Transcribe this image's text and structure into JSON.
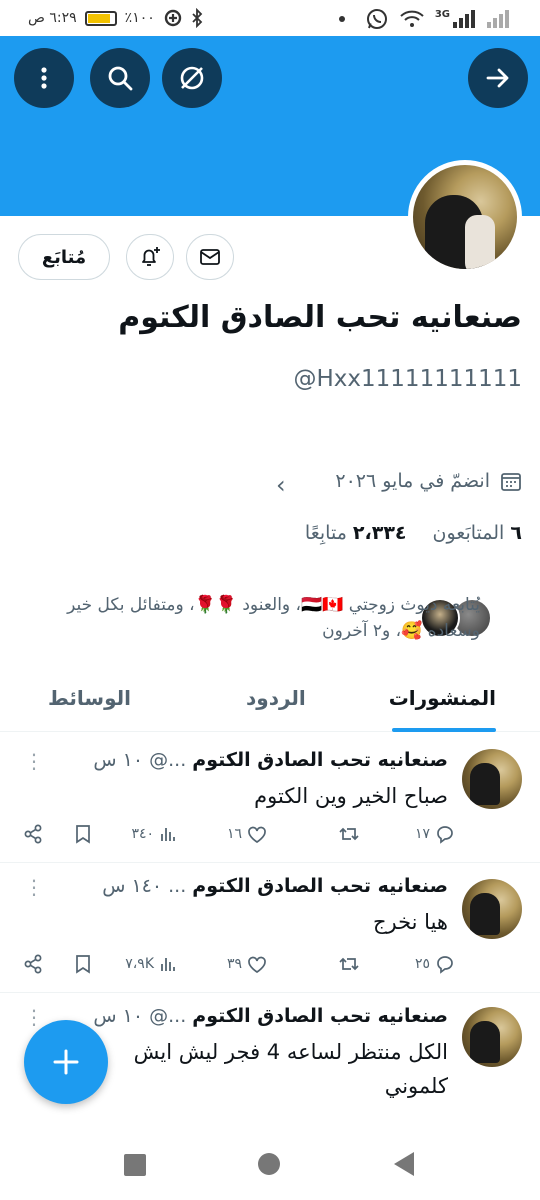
{
  "status_bar": {
    "time": "٦:٢٩ ص",
    "battery_percent": "٪١٠٠",
    "battery_level": 0.8,
    "network": "3G"
  },
  "header": {
    "menu_icon": "more-vertical-icon",
    "search_icon": "search-icon",
    "translate_icon": "slash-circle-icon",
    "forward_icon": "arrow-right-icon",
    "banner_color": "#1d9bf0"
  },
  "profile": {
    "follow_button_label": "مُتابَع",
    "name": "صنعانيه تحب الصادق الكتوم",
    "handle": "@Hxx11111111111",
    "joined": "انضمّ في مايو ٢٠٢٦",
    "followers_count": "٦",
    "followers_label": "المتابَعون",
    "following_count": "٢،٣٣٤",
    "following_label": "متابِعًا",
    "mutual_followers_text": "يُتابعه ديوث زوجتي 🇾🇪🇨🇦، والعنود 🌹🌹، ومتفائل بكل خير وسعاده 🥰، و٢ آخرون"
  },
  "tabs": [
    {
      "label": "المنشورات",
      "active": true
    },
    {
      "label": "الردود",
      "active": false
    },
    {
      "label": "الوسائط",
      "active": false
    }
  ],
  "posts": [
    {
      "name": "صنعانيه تحب الصادق الكتوم",
      "meta": "...@ ١٠ س",
      "body": "صباح الخير وين الكتوم",
      "replies": "١٧",
      "likes": "١٦",
      "views": "٣٤٠"
    },
    {
      "name": "صنعانيه تحب الصادق الكتوم",
      "meta": "... ١٤٠ س",
      "body": "هيا نخرج",
      "replies": "٢٥",
      "likes": "٣٩",
      "views": "٧،٩K"
    },
    {
      "name": "صنعانيه تحب الصادق الكتوم",
      "meta": "...@ ١٠ س",
      "body": "الكل منتظر لساعه 4 فجر ليش ايش كلموني",
      "replies": "",
      "likes": "",
      "views": ""
    }
  ],
  "fab": {
    "icon": "plus-icon",
    "color": "#1d9bf0"
  },
  "nav_bar": {
    "recents_icon": "square-icon",
    "home_icon": "circle-icon",
    "back_icon": "back-triangle-icon"
  }
}
